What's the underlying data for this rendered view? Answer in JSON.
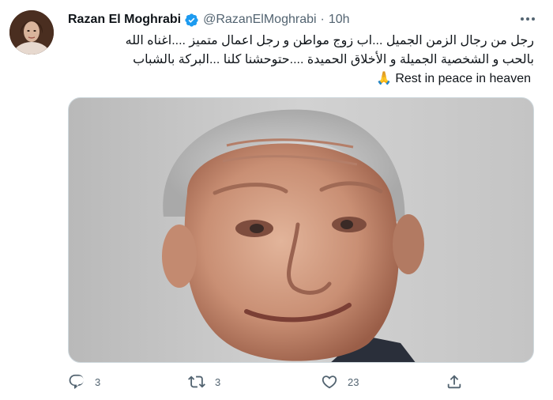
{
  "author": {
    "name": "Razan El Moghrabi",
    "handle": "@RazanElMoghrabi",
    "separator": "·",
    "time": "10h"
  },
  "tweet": {
    "line1": "رجل من رجال الزمن الجميل ...اب زوج مواطن و رجل اعمال متميز ....اغناه الله",
    "line2": "بالحب و الشخصية الجميلة و الأخلاق الحميدة ....حتوحشنا كلنا ...البركة بالشباب",
    "line3_emoji": "🙏",
    "line3_text": "Rest in peace in heaven"
  },
  "actions": {
    "replies": "3",
    "retweets": "3",
    "likes": "23"
  },
  "colors": {
    "verified": "#1d9bf0",
    "muted": "#536471",
    "text": "#0f1419",
    "border": "#cfd9de"
  },
  "icons": [
    "verified-badge-icon",
    "more-icon",
    "reply-icon",
    "retweet-icon",
    "like-icon",
    "share-icon"
  ]
}
